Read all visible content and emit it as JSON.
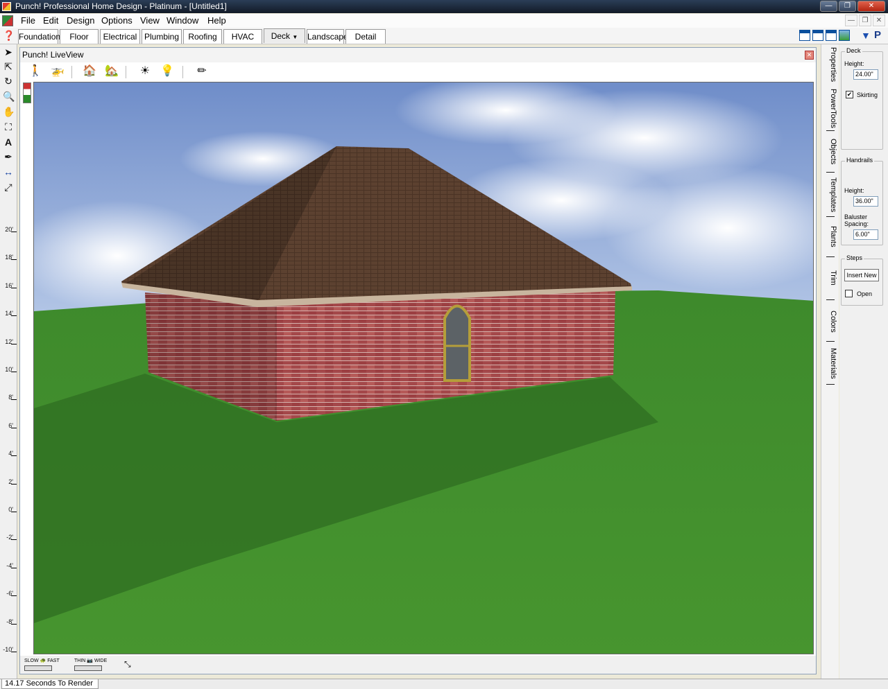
{
  "app": {
    "title": "Punch! Professional Home Design - Platinum - [Untitled1]"
  },
  "menu": [
    "File",
    "Edit",
    "Design",
    "Options",
    "View",
    "Window",
    "Help"
  ],
  "tabs": [
    "Foundation",
    "Floor",
    "Electrical",
    "Plumbing",
    "Roofing",
    "HVAC",
    "Deck",
    "Landscape",
    "Detail"
  ],
  "active_tab": "Deck",
  "liveview": {
    "title": "Punch! LiveView",
    "render_speed_slow": "SLOW",
    "render_speed_fast": "FAST",
    "line_thin": "THIN",
    "line_wide": "WIDE"
  },
  "ruler": [
    "20'",
    "18'",
    "16'",
    "14'",
    "12'",
    "10'",
    "8'",
    "6'",
    "4'",
    "2'",
    "0'",
    "-2'",
    "-4'",
    "-6'",
    "-8'",
    "-10'"
  ],
  "side_tabs": [
    "Properties",
    "PowerTools",
    "Objects",
    "Templates",
    "Plants",
    "Trim",
    "Colors",
    "Materials"
  ],
  "properties": {
    "deck": {
      "label": "Deck",
      "height_label": "Height:",
      "height": "24.00\"",
      "skirting_label": "Skirting",
      "skirting_checked": true
    },
    "handrails": {
      "label": "Handrails",
      "height_label": "Height:",
      "height": "36.00\"",
      "baluster_label_1": "Baluster",
      "baluster_label_2": "Spacing:",
      "baluster_spacing": "6.00\""
    },
    "steps": {
      "label": "Steps",
      "insert_button": "Insert New",
      "open_label": "Open",
      "open_checked": false
    }
  },
  "status": {
    "text": "14.17 Seconds To Render"
  },
  "colors": {
    "sky": "#7f9ccf",
    "grass": "#3f8a2a",
    "brick": "#a4484a",
    "roof": "#5a3f2e"
  }
}
